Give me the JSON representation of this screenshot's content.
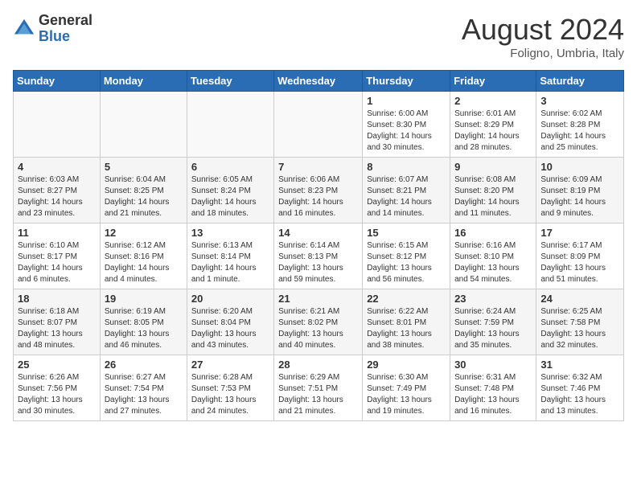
{
  "header": {
    "logo": {
      "general": "General",
      "blue": "Blue"
    },
    "title": "August 2024",
    "location": "Foligno, Umbria, Italy"
  },
  "calendar": {
    "weekdays": [
      "Sunday",
      "Monday",
      "Tuesday",
      "Wednesday",
      "Thursday",
      "Friday",
      "Saturday"
    ],
    "weeks": [
      [
        {
          "day": "",
          "info": ""
        },
        {
          "day": "",
          "info": ""
        },
        {
          "day": "",
          "info": ""
        },
        {
          "day": "",
          "info": ""
        },
        {
          "day": "1",
          "info": "Sunrise: 6:00 AM\nSunset: 8:30 PM\nDaylight: 14 hours\nand 30 minutes."
        },
        {
          "day": "2",
          "info": "Sunrise: 6:01 AM\nSunset: 8:29 PM\nDaylight: 14 hours\nand 28 minutes."
        },
        {
          "day": "3",
          "info": "Sunrise: 6:02 AM\nSunset: 8:28 PM\nDaylight: 14 hours\nand 25 minutes."
        }
      ],
      [
        {
          "day": "4",
          "info": "Sunrise: 6:03 AM\nSunset: 8:27 PM\nDaylight: 14 hours\nand 23 minutes."
        },
        {
          "day": "5",
          "info": "Sunrise: 6:04 AM\nSunset: 8:25 PM\nDaylight: 14 hours\nand 21 minutes."
        },
        {
          "day": "6",
          "info": "Sunrise: 6:05 AM\nSunset: 8:24 PM\nDaylight: 14 hours\nand 18 minutes."
        },
        {
          "day": "7",
          "info": "Sunrise: 6:06 AM\nSunset: 8:23 PM\nDaylight: 14 hours\nand 16 minutes."
        },
        {
          "day": "8",
          "info": "Sunrise: 6:07 AM\nSunset: 8:21 PM\nDaylight: 14 hours\nand 14 minutes."
        },
        {
          "day": "9",
          "info": "Sunrise: 6:08 AM\nSunset: 8:20 PM\nDaylight: 14 hours\nand 11 minutes."
        },
        {
          "day": "10",
          "info": "Sunrise: 6:09 AM\nSunset: 8:19 PM\nDaylight: 14 hours\nand 9 minutes."
        }
      ],
      [
        {
          "day": "11",
          "info": "Sunrise: 6:10 AM\nSunset: 8:17 PM\nDaylight: 14 hours\nand 6 minutes."
        },
        {
          "day": "12",
          "info": "Sunrise: 6:12 AM\nSunset: 8:16 PM\nDaylight: 14 hours\nand 4 minutes."
        },
        {
          "day": "13",
          "info": "Sunrise: 6:13 AM\nSunset: 8:14 PM\nDaylight: 14 hours\nand 1 minute."
        },
        {
          "day": "14",
          "info": "Sunrise: 6:14 AM\nSunset: 8:13 PM\nDaylight: 13 hours\nand 59 minutes."
        },
        {
          "day": "15",
          "info": "Sunrise: 6:15 AM\nSunset: 8:12 PM\nDaylight: 13 hours\nand 56 minutes."
        },
        {
          "day": "16",
          "info": "Sunrise: 6:16 AM\nSunset: 8:10 PM\nDaylight: 13 hours\nand 54 minutes."
        },
        {
          "day": "17",
          "info": "Sunrise: 6:17 AM\nSunset: 8:09 PM\nDaylight: 13 hours\nand 51 minutes."
        }
      ],
      [
        {
          "day": "18",
          "info": "Sunrise: 6:18 AM\nSunset: 8:07 PM\nDaylight: 13 hours\nand 48 minutes."
        },
        {
          "day": "19",
          "info": "Sunrise: 6:19 AM\nSunset: 8:05 PM\nDaylight: 13 hours\nand 46 minutes."
        },
        {
          "day": "20",
          "info": "Sunrise: 6:20 AM\nSunset: 8:04 PM\nDaylight: 13 hours\nand 43 minutes."
        },
        {
          "day": "21",
          "info": "Sunrise: 6:21 AM\nSunset: 8:02 PM\nDaylight: 13 hours\nand 40 minutes."
        },
        {
          "day": "22",
          "info": "Sunrise: 6:22 AM\nSunset: 8:01 PM\nDaylight: 13 hours\nand 38 minutes."
        },
        {
          "day": "23",
          "info": "Sunrise: 6:24 AM\nSunset: 7:59 PM\nDaylight: 13 hours\nand 35 minutes."
        },
        {
          "day": "24",
          "info": "Sunrise: 6:25 AM\nSunset: 7:58 PM\nDaylight: 13 hours\nand 32 minutes."
        }
      ],
      [
        {
          "day": "25",
          "info": "Sunrise: 6:26 AM\nSunset: 7:56 PM\nDaylight: 13 hours\nand 30 minutes."
        },
        {
          "day": "26",
          "info": "Sunrise: 6:27 AM\nSunset: 7:54 PM\nDaylight: 13 hours\nand 27 minutes."
        },
        {
          "day": "27",
          "info": "Sunrise: 6:28 AM\nSunset: 7:53 PM\nDaylight: 13 hours\nand 24 minutes."
        },
        {
          "day": "28",
          "info": "Sunrise: 6:29 AM\nSunset: 7:51 PM\nDaylight: 13 hours\nand 21 minutes."
        },
        {
          "day": "29",
          "info": "Sunrise: 6:30 AM\nSunset: 7:49 PM\nDaylight: 13 hours\nand 19 minutes."
        },
        {
          "day": "30",
          "info": "Sunrise: 6:31 AM\nSunset: 7:48 PM\nDaylight: 13 hours\nand 16 minutes."
        },
        {
          "day": "31",
          "info": "Sunrise: 6:32 AM\nSunset: 7:46 PM\nDaylight: 13 hours\nand 13 minutes."
        }
      ]
    ]
  }
}
